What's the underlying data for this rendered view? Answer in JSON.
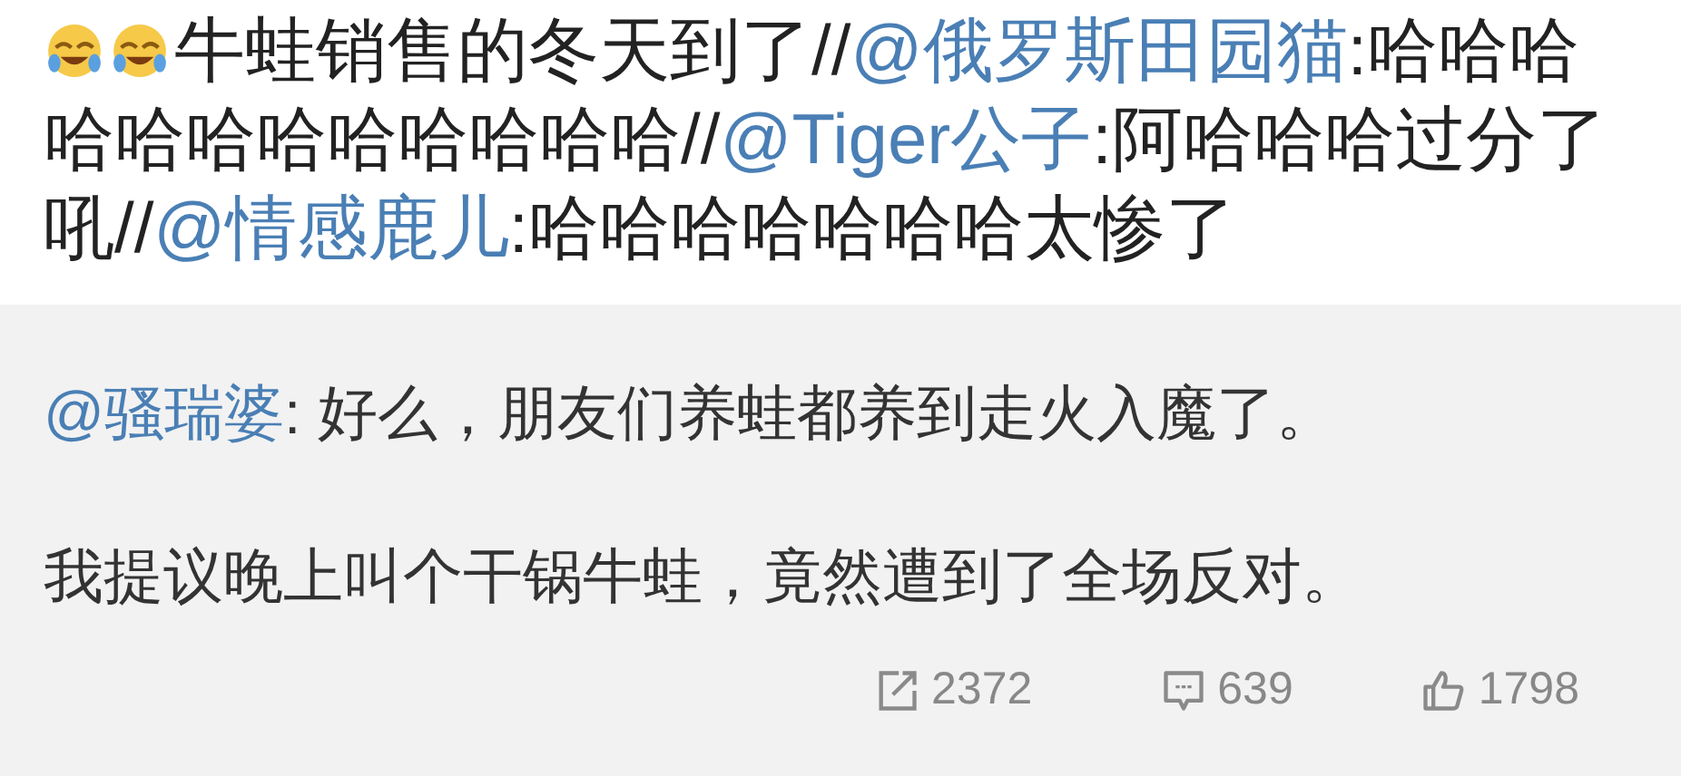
{
  "repost": {
    "emojis": [
      {
        "kind": "laughing-crying"
      },
      {
        "kind": "laughing-crying"
      }
    ],
    "segments": [
      {
        "kind": "text",
        "text": "牛蛙销售的冬天到了//"
      },
      {
        "kind": "mention",
        "text": "@俄罗斯田园猫"
      },
      {
        "kind": "text",
        "text": ":哈哈哈哈哈哈哈哈哈哈哈哈//"
      },
      {
        "kind": "mention",
        "text": "@Tiger公子"
      },
      {
        "kind": "text",
        "text": ":阿哈哈哈过分了吼//"
      },
      {
        "kind": "mention",
        "text": "@情感鹿儿"
      },
      {
        "kind": "text",
        "text": ":哈哈哈哈哈哈哈太惨了"
      }
    ]
  },
  "original": {
    "author": "@骚瑞婆",
    "first_text": ": 好么，朋友们养蛙都养到走火入魔了。",
    "second_paragraph": "我提议晚上叫个干锅牛蛙，竟然遭到了全场反对。"
  },
  "actions": [
    {
      "kind": "repost",
      "count": "2372"
    },
    {
      "kind": "comment",
      "count": "639"
    },
    {
      "kind": "like",
      "count": "1798"
    }
  ]
}
